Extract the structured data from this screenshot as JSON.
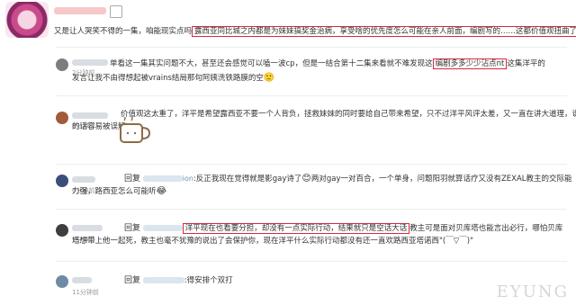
{
  "comments": [
    {
      "user_name": "",
      "time": "",
      "text_pre": "又是让人哭笑不得的一集，咱能现实点吗",
      "highlight": "露西亚同比城之内都是为妹妹搞奖金治病，享受啥的优先度怎么可能在亲人前面，编剧写的……这都价值观扭曲了"
    },
    {
      "user_name": "",
      "time": "2分钟前",
      "line1": "单看这一集其实问题不大，甚至还会感觉可以嗑一波cp，但是一结合第十二集来看就不难发现这",
      "highlight": "编剧多多少少沾点nt",
      "line1_tail": "这集洋平的",
      "line2": "发言让我不由得想起被vrains结局那句阿姨洗铁路膜的空"
    },
    {
      "user_name": "",
      "time": "6分钟前",
      "line1": "价值观这太重了，洋平是希望露西亚不要一个人背负，拯救妹妹的同时要给自己带来希望，只不过洋平风评太差，又一直在讲大道理，说",
      "line2": "的话容易被误解"
    },
    {
      "user_name": "",
      "time": "6分钟前",
      "reply_label": "回复",
      "mention": "ion",
      "line1": ":反正我现在觉得就是影gay诗了",
      "line1_b": "两对gay一对百合，一个单身，问题阳羽就算话疗又没有ZEXAL教主的交际能",
      "line2": "力强，路西亚怎么可能听"
    },
    {
      "user_name": "",
      "time": "7分钟前",
      "reply_label": "回复",
      "highlight": "洋平现在也看要分担，却没有一点实际行动，结果就只是空话大话",
      "line1_tail": "教主可是面对贝库塔也能言出必行，哪怕贝库",
      "line2": "塔想带上他一起死，教主也毫不犹豫的说出了会保护你，现在洋平什么实际行动都没有还一直欢路西亚塔诺西\"(￣▽￣)\""
    },
    {
      "user_name": "",
      "time": "11分钟前",
      "reply_label": "回复",
      "line1": ":得安排个双打"
    }
  ],
  "watermark": "EYUNG"
}
